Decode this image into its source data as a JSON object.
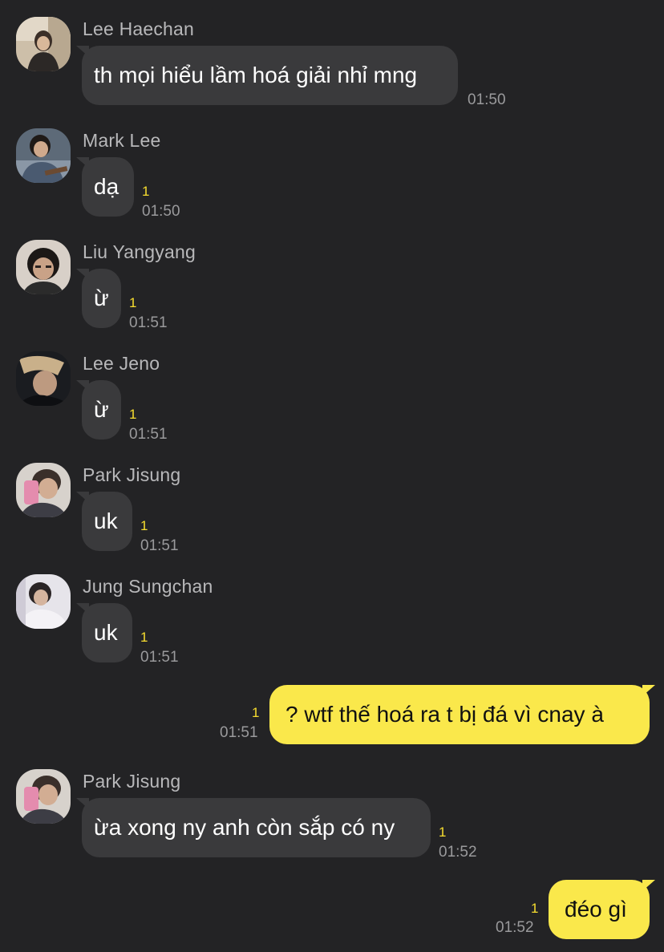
{
  "messages": [
    {
      "sender": "Lee Haechan",
      "text": "th mọi hiểu lầm hoá giải nhỉ mng",
      "unread": "",
      "time": "01:50",
      "avatar_icon": "user-photo-icon"
    },
    {
      "sender": "Mark Lee",
      "text": "dạ",
      "unread": "1",
      "time": "01:50",
      "avatar_icon": "user-photo-icon"
    },
    {
      "sender": "Liu Yangyang",
      "text": "ừ",
      "unread": "1",
      "time": "01:51",
      "avatar_icon": "user-photo-icon"
    },
    {
      "sender": "Lee Jeno",
      "text": "ừ",
      "unread": "1",
      "time": "01:51",
      "avatar_icon": "user-photo-icon"
    },
    {
      "sender": "Park Jisung",
      "text": "uk",
      "unread": "1",
      "time": "01:51",
      "avatar_icon": "user-photo-icon"
    },
    {
      "sender": "Jung Sungchan",
      "text": "uk",
      "unread": "1",
      "time": "01:51",
      "avatar_icon": "user-photo-icon"
    },
    {
      "sender": "",
      "text": "? wtf thế hoá ra t bị đá vì cnay à",
      "unread": "1",
      "time": "01:51",
      "outgoing": true
    },
    {
      "sender": "Park Jisung",
      "text": "ừa xong ny anh còn sắp có ny",
      "unread": "1",
      "time": "01:52",
      "avatar_icon": "user-photo-icon"
    },
    {
      "sender": "",
      "text": "đéo gì",
      "unread": "1",
      "time": "01:52",
      "outgoing": true
    }
  ],
  "colors": {
    "background": "#232325",
    "incoming_bubble": "#3a3a3c",
    "outgoing_bubble": "#fae84b",
    "unread_count": "#f7dd2f",
    "timestamp": "#9a9a9c",
    "sender_name": "#b8b8ba"
  }
}
